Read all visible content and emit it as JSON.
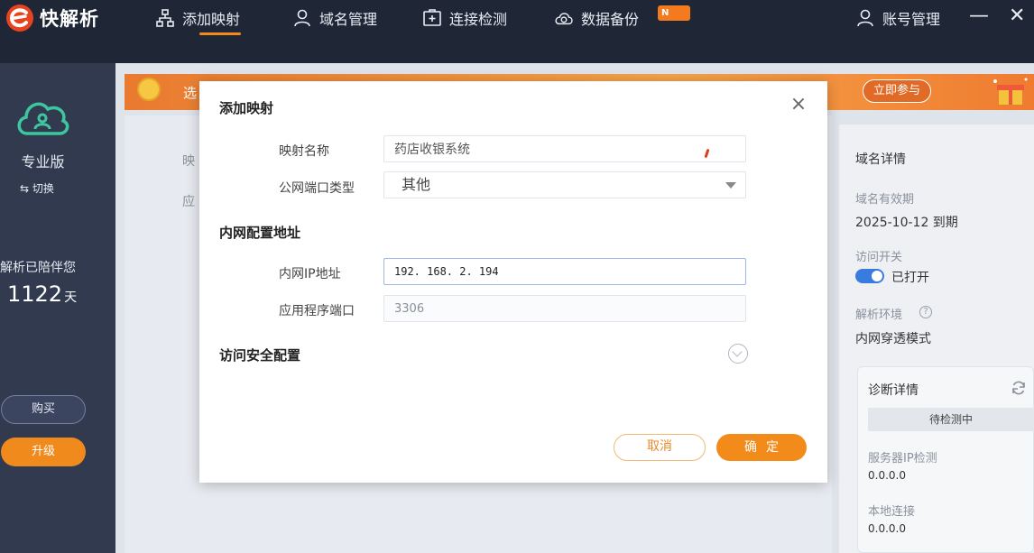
{
  "app": {
    "logo_text": "快解析",
    "logo_icon": "e-logo-icon"
  },
  "nav": {
    "items": [
      {
        "label": "添加映射",
        "icon": "network-icon",
        "active": true
      },
      {
        "label": "域名管理",
        "icon": "user-icon"
      },
      {
        "label": "连接检测",
        "icon": "plus-box-icon"
      },
      {
        "label": "数据备份",
        "icon": "cloud-sync-icon",
        "badge": "N"
      }
    ],
    "account": {
      "label": "账号管理",
      "icon": "user-icon"
    },
    "minimize": "—",
    "close": "✕"
  },
  "sidebar": {
    "edition": "专业版",
    "switch_label": "⇆ 切换",
    "accompany_text": "快解析已陪伴您",
    "days_value": "1122",
    "days_unit": "天",
    "buy_label": "购买",
    "upgrade_label": "升级"
  },
  "banner": {
    "text_partial": "选",
    "cta_label": "立即参与"
  },
  "main": {
    "label_1": "映",
    "label_2": "应"
  },
  "right_panel": {
    "title": "域名详情",
    "expiry_label": "域名有效期",
    "expiry_value": "2025-10-12 到期",
    "access_label": "访问开关",
    "access_value": "已打开",
    "env_label": "解析环境",
    "env_value": "内网穿透模式",
    "diag_title": "诊断详情",
    "diag_status": "待检测中",
    "server_ip_label": "服务器IP检测",
    "server_ip_value": "0.0.0.0",
    "local_conn_label": "本地连接",
    "local_conn_value": "0.0.0.0"
  },
  "modal": {
    "title": "添加映射",
    "close_symbol": "×",
    "mapping_name_label": "映射名称",
    "mapping_name_value": "药店收银系统",
    "port_type_label": "公网端口类型",
    "port_type_value": "其他",
    "intranet_section": "内网配置地址",
    "ip_label": "内网IP地址",
    "ip_value": "192. 168. 2. 194",
    "app_port_label": "应用程序端口",
    "app_port_value": "3306",
    "security_section": "访问安全配置",
    "cancel_label": "取消",
    "ok_label": "确定"
  },
  "colors": {
    "accent": "#f28b1a",
    "topbar": "#1f2636",
    "sidebar": "#313a4e",
    "toggle_on": "#3a7be0"
  }
}
